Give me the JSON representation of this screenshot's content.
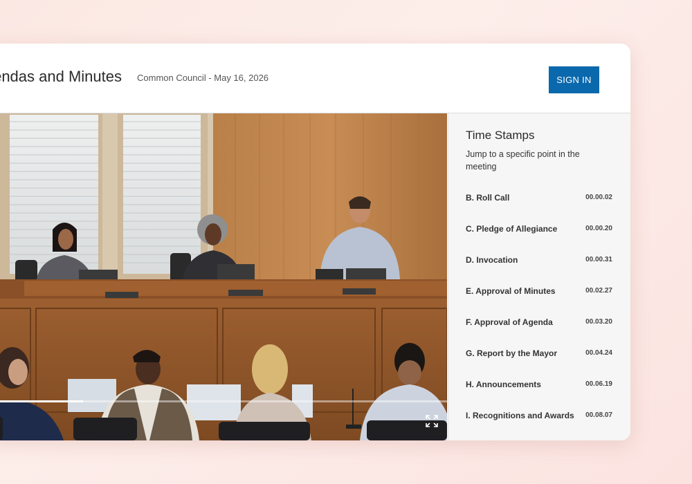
{
  "header": {
    "title": "Agendas and Minutes",
    "subtitle": "Common Council - May 16, 2026",
    "sign_in_label": "SIGN IN"
  },
  "video": {
    "progress": 0.21,
    "fullscreen_icon": "fullscreen-icon"
  },
  "sidebar": {
    "title": "Time Stamps",
    "subtitle": "Jump to a specific point in the meeting",
    "items": [
      {
        "label": "B. Roll Call",
        "time": "00.00.02"
      },
      {
        "label": "C. Pledge of Allegiance",
        "time": "00.00.20"
      },
      {
        "label": "D. Invocation",
        "time": "00.00.31"
      },
      {
        "label": "E. Approval of Minutes",
        "time": "00.02.27"
      },
      {
        "label": "F. Approval of Agenda",
        "time": "00.03.20"
      },
      {
        "label": "G. Report by the Mayor",
        "time": "00.04.24"
      },
      {
        "label": "H. Announcements",
        "time": "00.06.19"
      },
      {
        "label": "I. Recognitions and Awards",
        "time": "00.08.07"
      }
    ]
  },
  "colors": {
    "accent": "#0a68ad",
    "background": "#fdeeea",
    "sidebar_bg": "#f6f6f6"
  }
}
